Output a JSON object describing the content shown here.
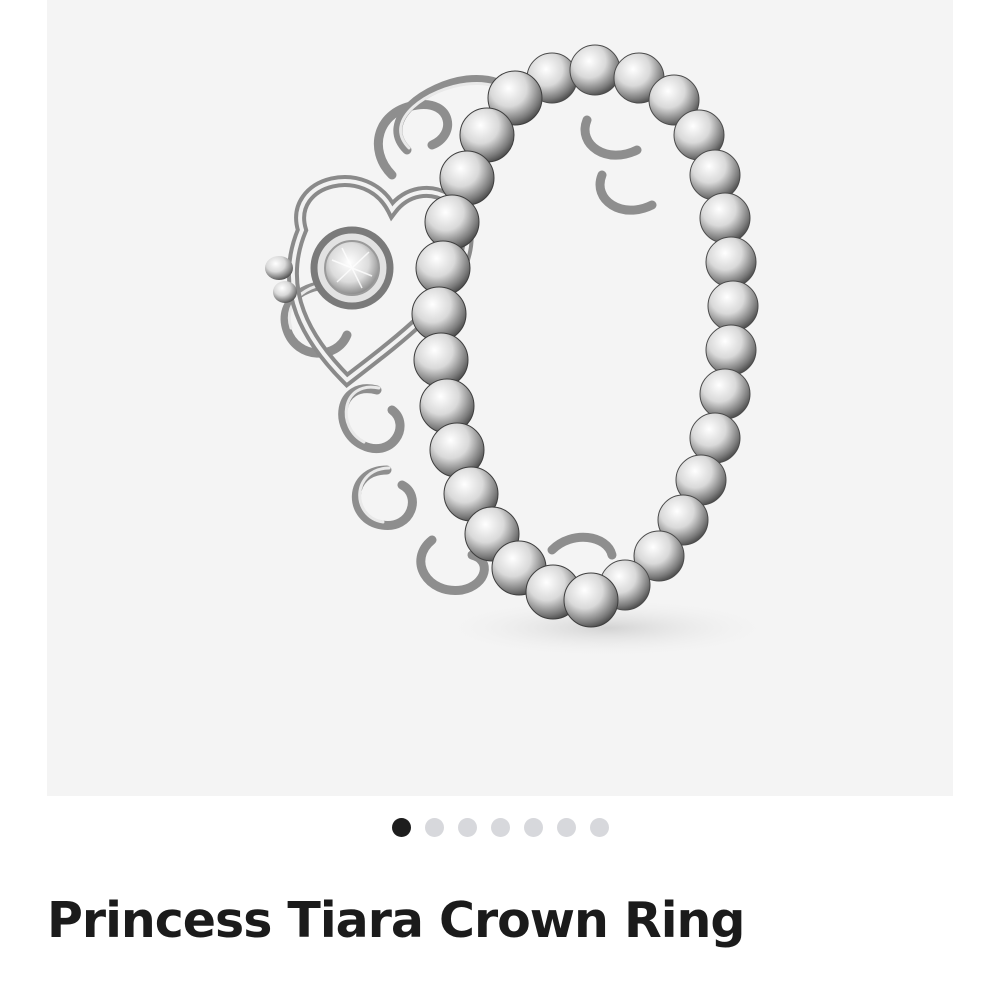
{
  "product": {
    "title": "Princess Tiara Crown Ring",
    "gallery": {
      "image_icon": "silver-tiara-ring",
      "background_color": "#f4f4f4",
      "next_icon": "chevron-right-icon",
      "dot_count": 7,
      "active_index": 0,
      "active_dot_color": "#1d1d1d",
      "inactive_dot_color": "#d7d8dc"
    }
  }
}
